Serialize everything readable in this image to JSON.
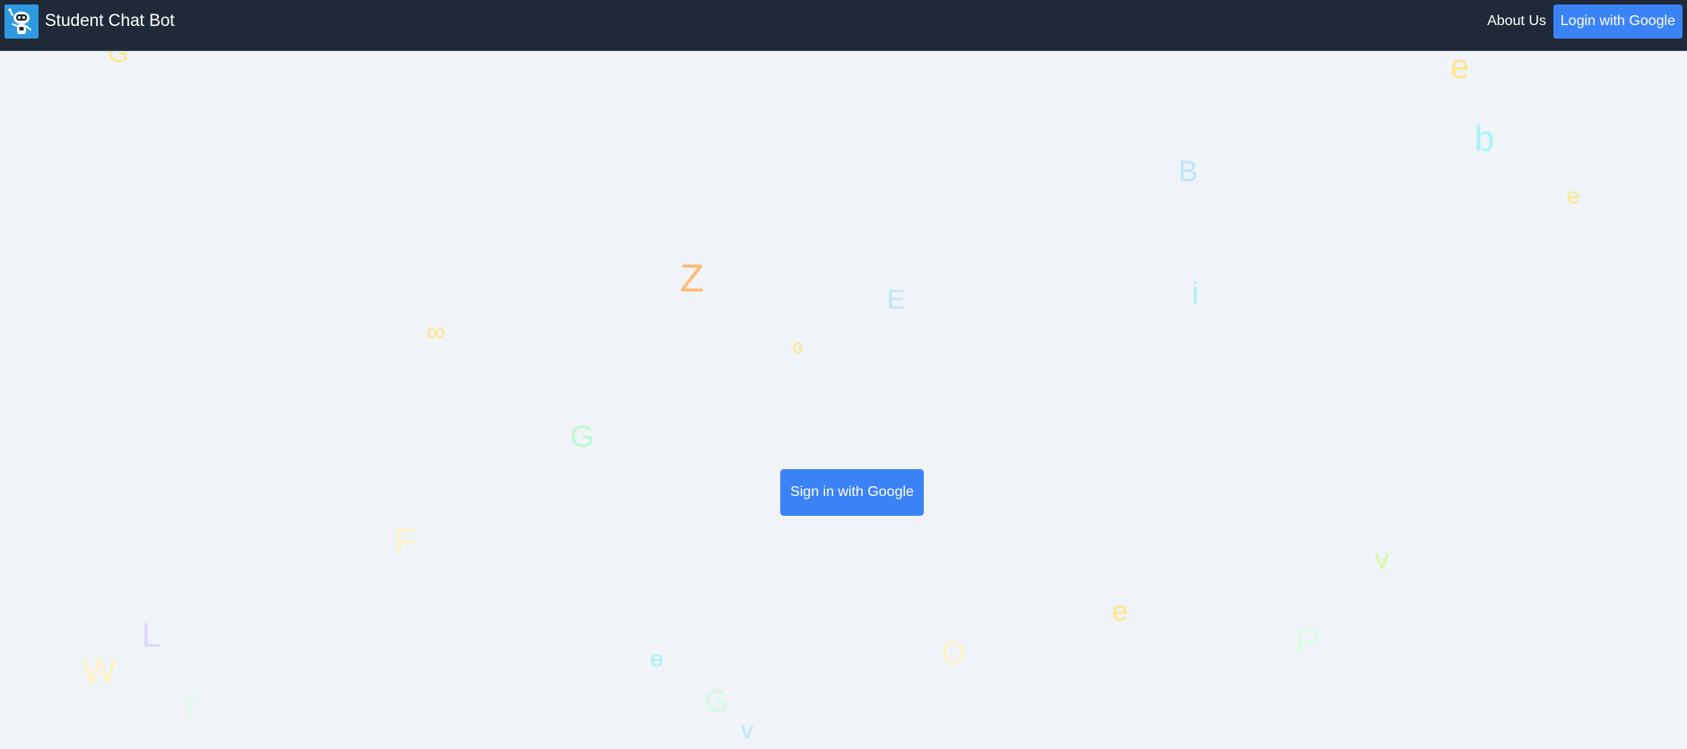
{
  "header": {
    "brand": "Student Chat Bot",
    "logo_icon": "robot-icon",
    "nav_about": "About Us",
    "login_button": "Login with Google"
  },
  "main": {
    "signin_button": "Sign in with Google"
  },
  "background_letters": [
    {
      "char": "e",
      "color": "#fde68a"
    },
    {
      "char": "b",
      "color": "#a5f3fc"
    },
    {
      "char": "B",
      "color": "#bae6fd"
    },
    {
      "char": "e",
      "color": "#fde68a"
    },
    {
      "char": "Z",
      "color": "#fdba74"
    },
    {
      "char": "E",
      "color": "#bae6fd"
    },
    {
      "char": "i",
      "color": "#a5f3fc"
    },
    {
      "char": "∞",
      "color": "#fde68a"
    },
    {
      "char": "ɞ",
      "color": "#fde68a"
    },
    {
      "char": "G",
      "color": "#bbf7d0"
    },
    {
      "char": "F",
      "color": "#fef3c7"
    },
    {
      "char": "v",
      "color": "#d9f99d"
    },
    {
      "char": "e",
      "color": "#fde68a"
    },
    {
      "char": "L",
      "color": "#ddd6fe"
    },
    {
      "char": "W",
      "color": "#fef3c7"
    },
    {
      "char": "ɵ",
      "color": "#a5f3fc"
    },
    {
      "char": "O",
      "color": "#fef3c7"
    },
    {
      "char": "P",
      "color": "#dcfce7"
    },
    {
      "char": "T",
      "color": "#dcfce7"
    },
    {
      "char": "G",
      "color": "#d1fae5"
    },
    {
      "char": "v",
      "color": "#bae6fd"
    },
    {
      "char": "G",
      "color": "#fde68a"
    }
  ],
  "colors": {
    "navbar": "#1f2937",
    "accent": "#3b82f6",
    "background": "#f0f3f7"
  }
}
